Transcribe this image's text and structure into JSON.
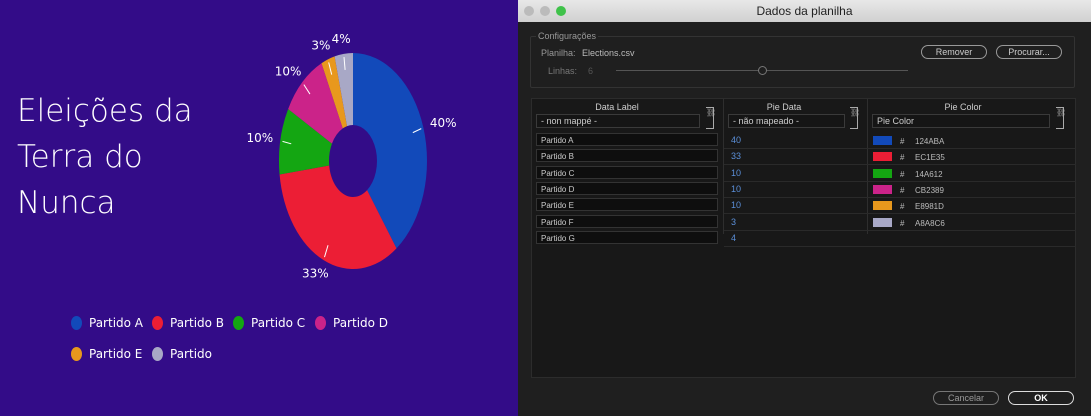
{
  "slide": {
    "title": "Eleições da Terra do Nunca"
  },
  "chart_data": {
    "type": "pie",
    "donut": true,
    "categories": [
      "Partido A",
      "Partido B",
      "Partido C",
      "Partido D",
      "Partido E",
      "Partido"
    ],
    "values": [
      40,
      33,
      10,
      10,
      3,
      4
    ],
    "labels": [
      "40%",
      "33%",
      "10%",
      "10%",
      "3%",
      "4%"
    ],
    "colors": [
      "#124ABA",
      "#EC1E35",
      "#14A612",
      "#CB2389",
      "#E8981D",
      "#A8A8C6"
    ],
    "legend": "bottom"
  },
  "dialog": {
    "title": "Dados da planilha",
    "settings_label": "Configurações",
    "sheet_label": "Planilha:",
    "sheet_value": "Elections.csv",
    "rows_label": "Linhas:",
    "rows_value": "6",
    "rows_fraction": 0.5,
    "remove": "Remover",
    "browse": "Procurar...",
    "cancel": "Cancelar",
    "ok": "OK",
    "columns": [
      {
        "header": "Data Label",
        "mapping": "- non mappé -"
      },
      {
        "header": "Pie Data",
        "mapping": "- não mapeado -"
      },
      {
        "header": "Pie Color",
        "mapping": "Pie Color"
      }
    ],
    "rows": [
      {
        "label": "Partido A",
        "data": "40",
        "color": "124ABA"
      },
      {
        "label": "Partido B",
        "data": "33",
        "color": "EC1E35"
      },
      {
        "label": "Partido C",
        "data": "10",
        "color": "14A612"
      },
      {
        "label": "Partido D",
        "data": "10",
        "color": "CB2389"
      },
      {
        "label": "Partido E",
        "data": "10",
        "color": "E8981D"
      },
      {
        "label": "Partido F",
        "data": "3",
        "color": "A8A8C6"
      },
      {
        "label": "Partido G",
        "data": "4",
        "color": ""
      }
    ],
    "hash": "#"
  }
}
